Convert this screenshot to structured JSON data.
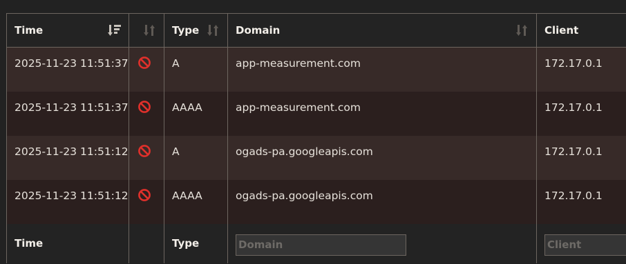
{
  "columns": {
    "time": "Time",
    "status": "",
    "type": "Type",
    "domain": "Domain",
    "client": "Client"
  },
  "rows": [
    {
      "time": "2025-11-23 11:51:37",
      "status_icon": "blocked-icon",
      "type": "A",
      "domain": "app-measurement.com",
      "client": "172.17.0.1"
    },
    {
      "time": "2025-11-23 11:51:37",
      "status_icon": "blocked-icon",
      "type": "AAAA",
      "domain": "app-measurement.com",
      "client": "172.17.0.1"
    },
    {
      "time": "2025-11-23 11:51:12",
      "status_icon": "blocked-icon",
      "type": "A",
      "domain": "ogads-pa.googleapis.com",
      "client": "172.17.0.1"
    },
    {
      "time": "2025-11-23 11:51:12",
      "status_icon": "blocked-icon",
      "type": "AAAA",
      "domain": "ogads-pa.googleapis.com",
      "client": "172.17.0.1"
    }
  ],
  "footer": {
    "time": "Time",
    "type": "Type",
    "domain_filter": {
      "value": "",
      "placeholder": "Domain"
    },
    "client_filter": {
      "value": "",
      "placeholder": "Client"
    }
  },
  "colors": {
    "background": "#222222",
    "row_odd": "#372a28",
    "row_even": "#2b1f1e",
    "blocked_icon": "#e0302b",
    "sort_icon_active": "#c9c4bd",
    "sort_icon_inactive": "#5f5a55"
  },
  "sort": {
    "time": "descending-active",
    "status": "unsorted",
    "type": "unsorted",
    "domain": "unsorted"
  }
}
